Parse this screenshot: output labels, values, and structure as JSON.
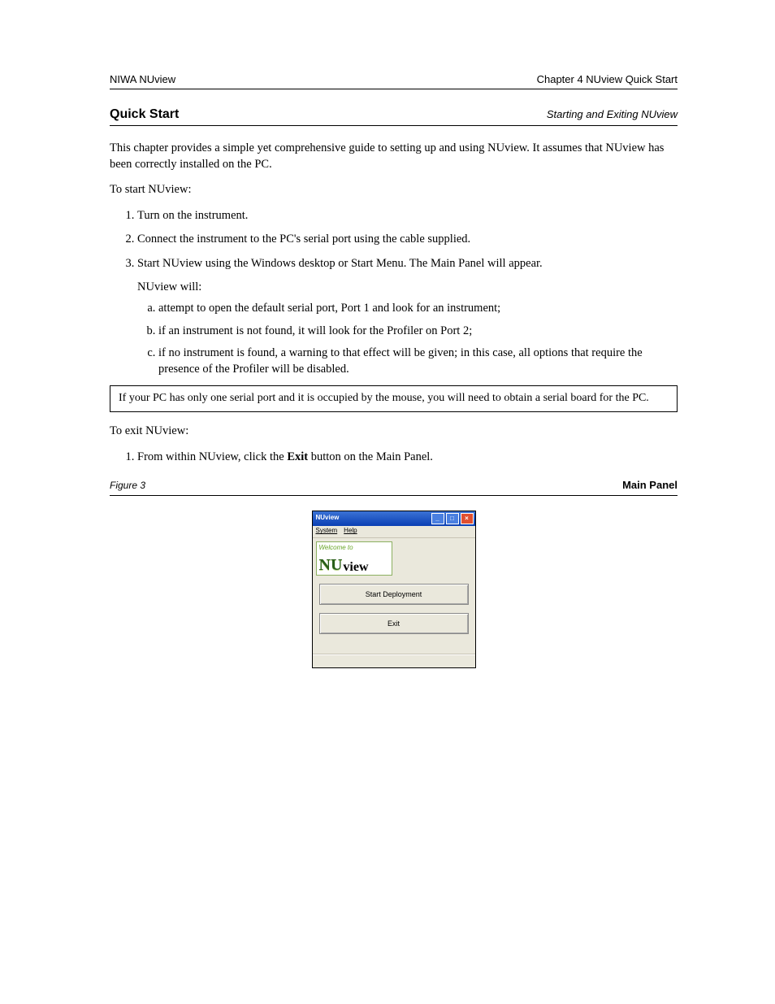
{
  "header": {
    "left": "NIWA NUview",
    "right": "Chapter 4  NUview Quick Start"
  },
  "section": {
    "title": "Quick Start",
    "sub": "Starting and Exiting NUview"
  },
  "intro": "This chapter provides a simple yet comprehensive guide to setting up and using NUview. It assumes that NUview has been correctly installed on the PC.",
  "to_start": "To start NUview:",
  "steps": [
    "Turn on the instrument.",
    "Connect the instrument to the PC's  serial port using the cable supplied.",
    "Start NUview using the Windows desktop or Start Menu. The Main Panel will appear."
  ],
  "substeps": [
    "attempt to open the default serial port, Port 1 and look for an instrument;",
    "if an instrument is not found, it will look for the Profiler on Port 2;",
    "if no instrument is found, a warning to that effect will be given; in this case, all options that require the presence of the Profiler will be disabled."
  ],
  "list_intro": "NUview will:",
  "note": "If your PC has only one serial port and it is occupied by the mouse, you will need to obtain a serial board for the PC.",
  "to_exit": "To exit NUview:",
  "exit_item": "From within NUview, click the ",
  "exit_btn": "Exit",
  "exit_tail": " button on the Main Panel.",
  "figure": {
    "label": "Figure 3",
    "name": "Main Panel"
  },
  "window": {
    "title": "NUview",
    "menu1": "System",
    "menu2": "Help",
    "welcome": "Welcome to",
    "logo_nu": "NU",
    "logo_view": "view",
    "btn_start": "Start Deployment",
    "btn_exit": "Exit"
  }
}
